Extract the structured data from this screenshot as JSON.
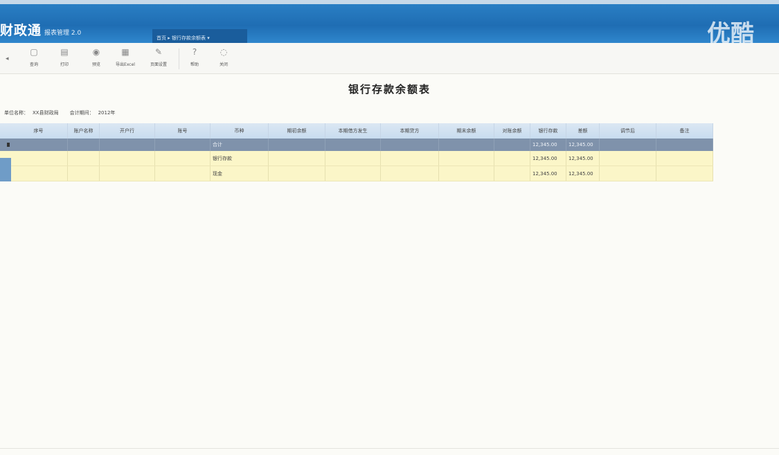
{
  "header": {
    "logo_main": "财政通",
    "logo_sub": "报表管理  2.0",
    "nav_tab": "首页 ▸ 银行存款余额表  ▾",
    "brand": "优酷"
  },
  "toolbar": {
    "buttons": [
      {
        "label": "查询",
        "icon": "▢"
      },
      {
        "label": "打印",
        "icon": "▤"
      },
      {
        "label": "预览",
        "icon": "◉"
      },
      {
        "label": "导出Excel",
        "icon": "▦"
      },
      {
        "label": "页面设置",
        "icon": "✎"
      },
      {
        "label": "帮助",
        "icon": "?"
      },
      {
        "label": "关闭",
        "icon": "◌"
      }
    ]
  },
  "report": {
    "title": "银行存款余额表",
    "filter_unit_label": "单位名称：",
    "filter_unit_value": "XX县财政局",
    "filter_date_label": "会计期间：",
    "filter_date_value": "2012年"
  },
  "grid": {
    "columns": [
      "序号",
      "账户名称",
      "开户行",
      "账号",
      "币种",
      "期初余额",
      "本期借方发生",
      "本期贷方",
      "期末余额",
      "对账余额",
      "银行存款",
      "差额",
      "调节后",
      "备注"
    ],
    "rows": [
      {
        "c4": "合计",
        "c10": "12,345.00",
        "c11": "12,345.00"
      },
      {
        "c4": "银行存款",
        "c10": "12,345.00",
        "c11": "12,345.00"
      },
      {
        "c4": "现金",
        "c10": "12,345.00",
        "c11": "12,345.00"
      }
    ]
  }
}
